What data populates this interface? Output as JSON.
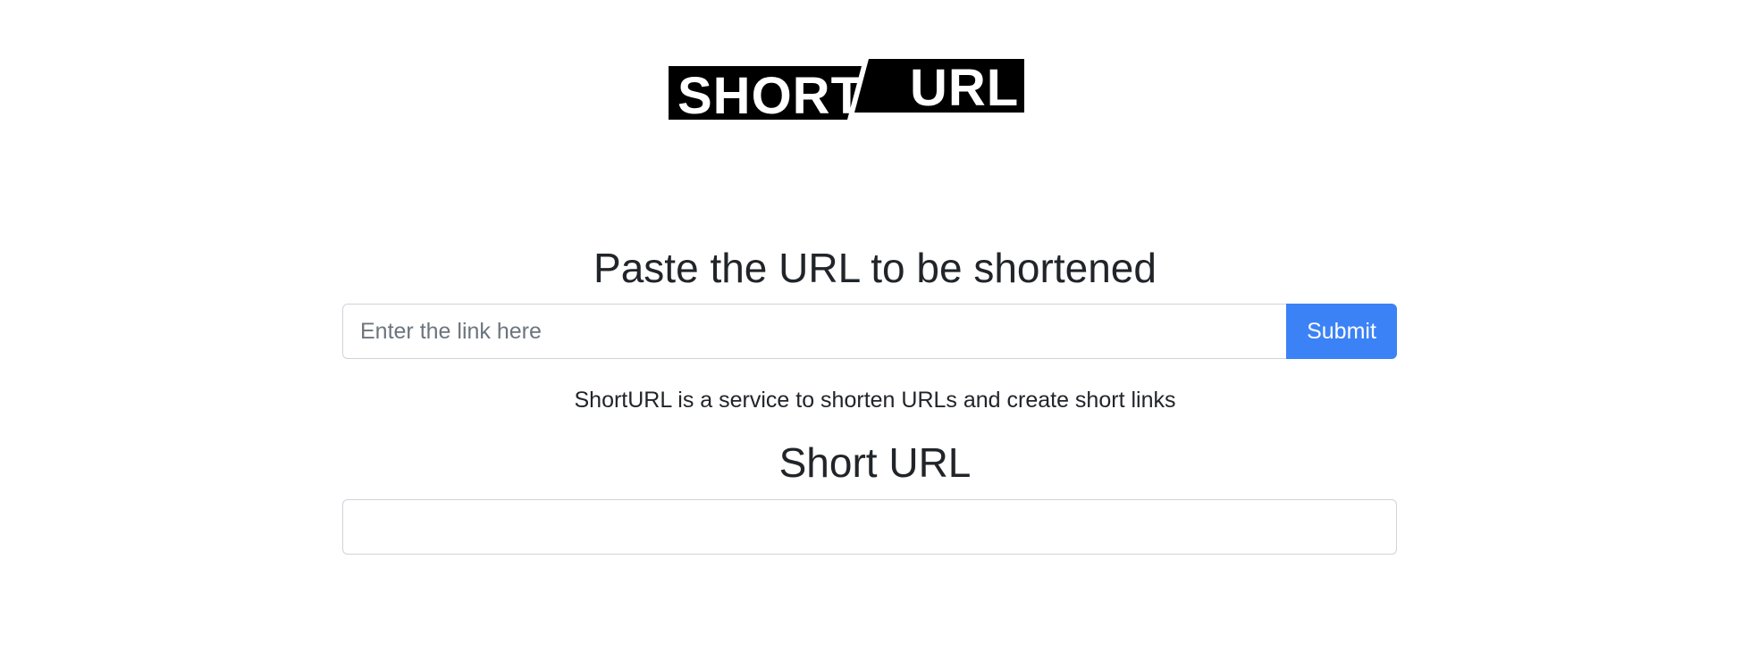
{
  "logo": {
    "part1": "SHORT",
    "part2": "URL"
  },
  "form": {
    "title": "Paste the URL to be shortened",
    "input_placeholder": "Enter the link here",
    "input_value": "",
    "submit_label": "Submit"
  },
  "description": "ShortURL is a service to shorten URLs and create short links",
  "result": {
    "title": "Short URL",
    "value": ""
  },
  "colors": {
    "accent": "#3b82f6",
    "text": "#212529",
    "border": "#ced4da",
    "logo_bg": "#000000"
  }
}
